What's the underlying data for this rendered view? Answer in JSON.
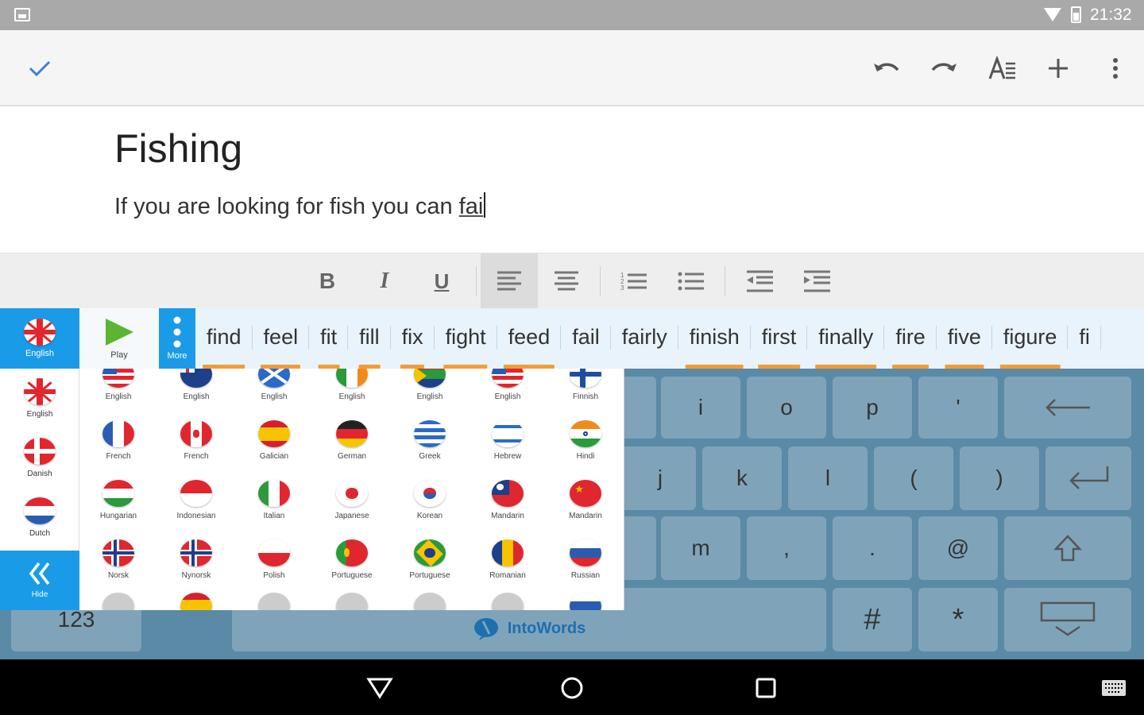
{
  "status_bar": {
    "time": "21:32"
  },
  "action_bar": {
    "done_icon": "check-icon",
    "actions": [
      "undo-icon",
      "redo-icon",
      "text-format-icon",
      "add-icon",
      "overflow-menu-icon"
    ],
    "accent_color": "#3f7fd4"
  },
  "document": {
    "title": "Fishing",
    "body_prefix": "If you are looking for fish you can ",
    "body_current_word": "fai"
  },
  "format_bar": {
    "bold": "B",
    "italic": "I",
    "underline": "U",
    "buttons": [
      "bold",
      "italic",
      "underline",
      "align-left",
      "align-center",
      "numbered-list",
      "bulleted-list",
      "outdent",
      "indent"
    ]
  },
  "suggestion_bar": {
    "language_label": "English",
    "play_label": "Play",
    "more_label": "More",
    "words": [
      "find",
      "feel",
      "fit",
      "fill",
      "fix",
      "fight",
      "feed",
      "fail",
      "fairly",
      "finish",
      "first",
      "finally",
      "fire",
      "five",
      "figure",
      "fi"
    ],
    "underline_fraction": [
      0.75,
      0.7,
      0.55,
      0.5,
      0.55,
      0.7,
      0.8,
      0,
      0,
      0.8,
      0.75,
      0.8,
      0.7,
      0.7,
      0.8,
      0
    ],
    "highlight_color": "#f39c35",
    "tab_color": "#1a9be8"
  },
  "language_panel": {
    "side": [
      {
        "label": "English",
        "flag": "uk"
      },
      {
        "label": "Danish",
        "flag": "dk"
      },
      {
        "label": "Dutch",
        "flag": "nl"
      }
    ],
    "hide_label": "Hide",
    "rows": [
      [
        {
          "label": "English",
          "flag": "us"
        },
        {
          "label": "English",
          "flag": "au"
        },
        {
          "label": "English",
          "flag": "sc"
        },
        {
          "label": "English",
          "flag": "ie"
        },
        {
          "label": "English",
          "flag": "za"
        },
        {
          "label": "English",
          "flag": "us2"
        },
        {
          "label": "Finnish",
          "flag": "fi"
        }
      ],
      [
        {
          "label": "French",
          "flag": "fr"
        },
        {
          "label": "French",
          "flag": "ca"
        },
        {
          "label": "Galician",
          "flag": "es"
        },
        {
          "label": "German",
          "flag": "de"
        },
        {
          "label": "Greek",
          "flag": "gr"
        },
        {
          "label": "Hebrew",
          "flag": "il"
        },
        {
          "label": "Hindi",
          "flag": "in"
        }
      ],
      [
        {
          "label": "Hungarian",
          "flag": "hu"
        },
        {
          "label": "Indonesian",
          "flag": "id"
        },
        {
          "label": "Italian",
          "flag": "it"
        },
        {
          "label": "Japanese",
          "flag": "jp"
        },
        {
          "label": "Korean",
          "flag": "kr"
        },
        {
          "label": "Mandarin",
          "flag": "tw"
        },
        {
          "label": "Mandarin",
          "flag": "cn"
        }
      ],
      [
        {
          "label": "Norsk",
          "flag": "no"
        },
        {
          "label": "Nynorsk",
          "flag": "no"
        },
        {
          "label": "Polish",
          "flag": "pl"
        },
        {
          "label": "Portuguese",
          "flag": "pt"
        },
        {
          "label": "Portuguese",
          "flag": "br"
        },
        {
          "label": "Romanian",
          "flag": "ro"
        },
        {
          "label": "Russian",
          "flag": "ru"
        }
      ]
    ]
  },
  "keyboard": {
    "row1": [
      "i",
      "o",
      "p",
      "'"
    ],
    "row2": [
      "j",
      "k",
      "l",
      "(",
      ")"
    ],
    "row3": [
      "m",
      ",",
      ".",
      "@"
    ],
    "row4_extra": [
      "#",
      "*"
    ],
    "numbers_key": "123",
    "space_label": "IntoWords",
    "key_color": "#7fa4ba",
    "background_color": "#5a8aa6"
  },
  "nav_bar": {
    "buttons": [
      "back-icon",
      "home-icon",
      "recents-icon",
      "keyboard-icon"
    ]
  }
}
